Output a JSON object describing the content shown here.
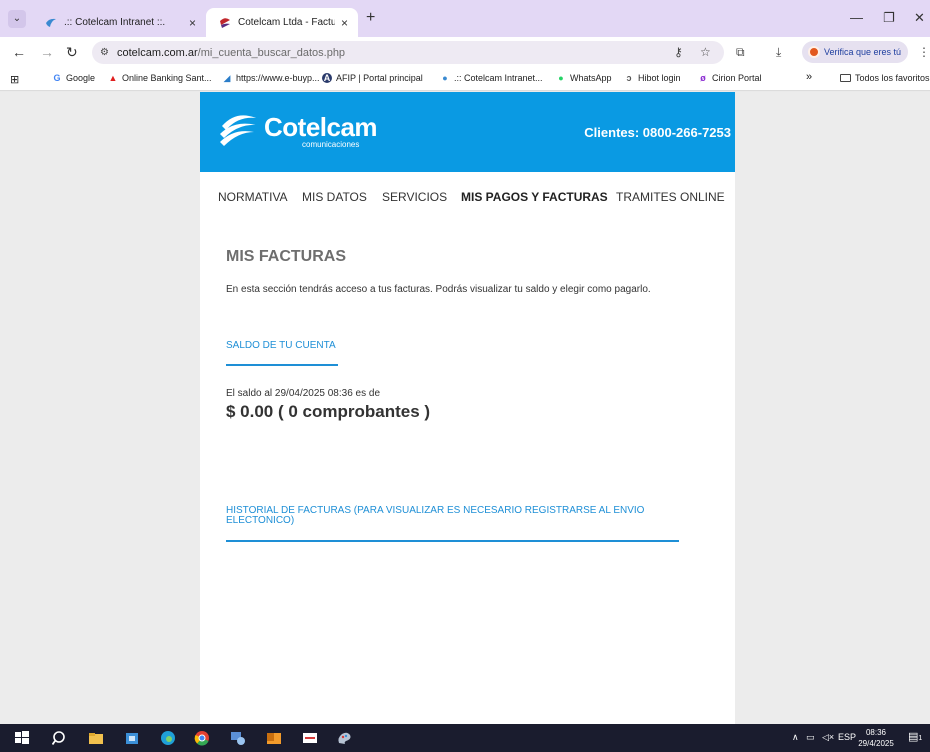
{
  "browser": {
    "tabs": [
      {
        "title": ".:: Cotelcam Intranet ::.",
        "active": false
      },
      {
        "title": "Cotelcam Ltda - Facturas",
        "active": true
      }
    ],
    "new_tab": "+",
    "close": "×",
    "url_host": "cotelcam.com.ar",
    "url_path": "/mi_cuenta_buscar_datos.php",
    "verify_label": "Verifica que eres tú",
    "bookmarks": [
      {
        "label": "Google",
        "icon": "G",
        "color": "#4285f4"
      },
      {
        "label": "Online Banking Sant...",
        "icon": "▲",
        "color": "#e01e1e"
      },
      {
        "label": "https://www.e-buyp...",
        "icon": "◢",
        "color": "#2a7dc9"
      },
      {
        "label": "AFIP | Portal principal",
        "icon": "A",
        "color": "#2a3a6b"
      },
      {
        "label": ".:: Cotelcam Intranet...",
        "icon": "●",
        "color": "#3a8ad1"
      },
      {
        "label": "WhatsApp",
        "icon": "●",
        "color": "#25d366"
      },
      {
        "label": "Hibot login",
        "icon": "ↄ",
        "color": "#555555"
      },
      {
        "label": "Cirion Portal",
        "icon": "ø",
        "color": "#8a2ad1"
      }
    ],
    "bookmarks_more": "»",
    "all_bookmarks": "Todos los favoritos"
  },
  "site": {
    "brand": "Cotelcam",
    "brand_sub": "comunicaciones",
    "phone": "Clientes: 0800-266-7253",
    "menu": [
      "NORMATIVA",
      "MIS DATOS",
      "SERVICIOS",
      "MIS PAGOS Y FACTURAS",
      "TRAMITES ONLINE"
    ],
    "title": "MIS FACTURAS",
    "intro": "En esta sección tendrás acceso a tus facturas. Podrás visualizar tu saldo y elegir como pagarlo.",
    "saldo_heading": "SALDO DE TU CUENTA",
    "saldo_label": "El saldo al 29/04/2025 08:36 es de",
    "saldo_value": "$ 0.00 ( 0 comprobantes )",
    "historial_heading": "HISTORIAL DE FACTURAS (PARA VISUALIZAR ES NECESARIO REGISTRARSE AL ENVIO ELECTONICO)"
  },
  "taskbar": {
    "lang": "ESP",
    "time": "08:36",
    "date": "29/4/2025",
    "notif_count": "1"
  },
  "colors": {
    "header_blue": "#0a9ae3",
    "link_blue": "#1e8fd6"
  }
}
